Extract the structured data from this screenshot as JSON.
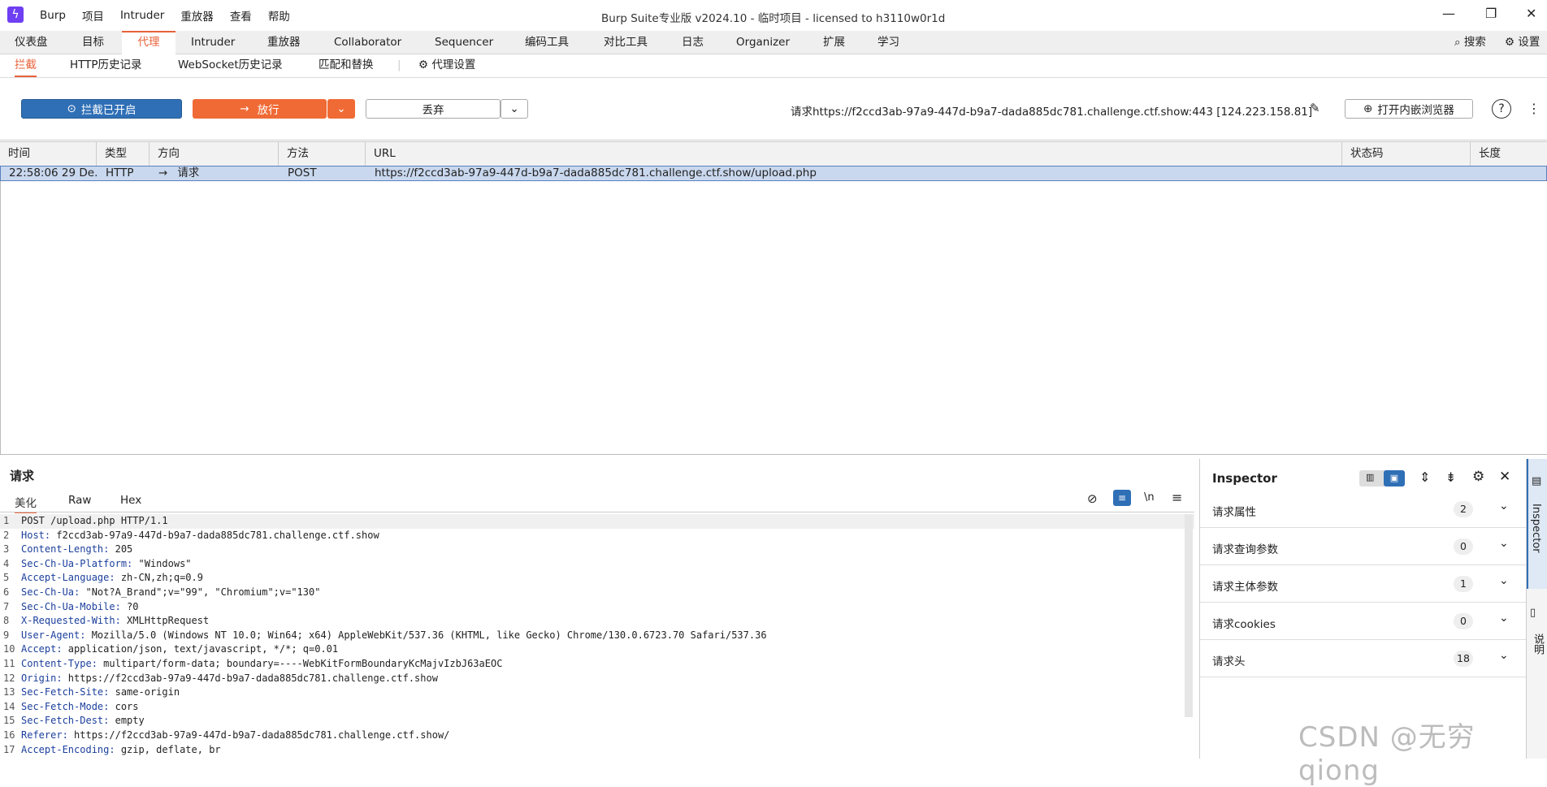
{
  "app": {
    "menu": [
      "Burp",
      "项目",
      "Intruder",
      "重放器",
      "查看",
      "帮助"
    ],
    "title": "Burp Suite专业版  v2024.10 - 临时项目 - licensed to h3110w0r1d"
  },
  "top_tabs": [
    "仪表盘",
    "目标",
    "代理",
    "Intruder",
    "重放器",
    "Collaborator",
    "Sequencer",
    "编码工具",
    "对比工具",
    "日志",
    "Organizer",
    "扩展",
    "学习"
  ],
  "top_right": {
    "search": "搜索",
    "settings": "设置"
  },
  "sub_tabs": [
    "拦截",
    "HTTP历史记录",
    "WebSocket历史记录",
    "匹配和替换",
    "代理设置"
  ],
  "toolbar": {
    "intercept": "拦截已开启",
    "forward": "放行",
    "drop": "丢弃",
    "request_info": "请求https://f2ccd3ab-97a9-447d-b9a7-dada885dc781.challenge.ctf.show:443  [124.223.158.81]",
    "open_browser": "打开内嵌浏览器",
    "help": "?"
  },
  "table": {
    "headers": [
      "时间",
      "类型",
      "方向",
      "方法",
      "URL",
      "状态码",
      "长度"
    ],
    "rows": [
      {
        "time": "22:58:06 29 De...",
        "type": "HTTP",
        "direction": "请求",
        "method": "POST",
        "url": "https://f2ccd3ab-97a9-447d-b9a7-dada885dc781.challenge.ctf.show/upload.php",
        "status": "",
        "length": ""
      }
    ]
  },
  "request_panel": {
    "title": "请求",
    "tabs": [
      "美化",
      "Raw",
      "Hex"
    ],
    "newline_toggle": "\\n",
    "lines": [
      {
        "n": "1",
        "key": "",
        "val": "POST /upload.php HTTP/1.1"
      },
      {
        "n": "2",
        "key": "Host:",
        "val": " f2ccd3ab-97a9-447d-b9a7-dada885dc781.challenge.ctf.show"
      },
      {
        "n": "3",
        "key": "Content-Length:",
        "val": " 205"
      },
      {
        "n": "4",
        "key": "Sec-Ch-Ua-Platform:",
        "val": " \"Windows\""
      },
      {
        "n": "5",
        "key": "Accept-Language:",
        "val": " zh-CN,zh;q=0.9"
      },
      {
        "n": "6",
        "key": "Sec-Ch-Ua:",
        "val": " \"Not?A_Brand\";v=\"99\", \"Chromium\";v=\"130\""
      },
      {
        "n": "7",
        "key": "Sec-Ch-Ua-Mobile:",
        "val": " ?0"
      },
      {
        "n": "8",
        "key": "X-Requested-With:",
        "val": " XMLHttpRequest"
      },
      {
        "n": "9",
        "key": "User-Agent:",
        "val": " Mozilla/5.0 (Windows NT 10.0; Win64; x64) AppleWebKit/537.36 (KHTML, like Gecko) Chrome/130.0.6723.70 Safari/537.36"
      },
      {
        "n": "10",
        "key": "Accept:",
        "val": " application/json, text/javascript, */*; q=0.01"
      },
      {
        "n": "11",
        "key": "Content-Type:",
        "val": " multipart/form-data; boundary=----WebKitFormBoundaryKcMajvIzbJ63aEOC"
      },
      {
        "n": "12",
        "key": "Origin:",
        "val": " https://f2ccd3ab-97a9-447d-b9a7-dada885dc781.challenge.ctf.show"
      },
      {
        "n": "13",
        "key": "Sec-Fetch-Site:",
        "val": " same-origin"
      },
      {
        "n": "14",
        "key": "Sec-Fetch-Mode:",
        "val": " cors"
      },
      {
        "n": "15",
        "key": "Sec-Fetch-Dest:",
        "val": " empty"
      },
      {
        "n": "16",
        "key": "Referer:",
        "val": " https://f2ccd3ab-97a9-447d-b9a7-dada885dc781.challenge.ctf.show/"
      },
      {
        "n": "17",
        "key": "Accept-Encoding:",
        "val": " gzip, deflate, br"
      }
    ]
  },
  "inspector": {
    "title": "Inspector",
    "sections": [
      {
        "label": "请求属性",
        "count": "2"
      },
      {
        "label": "请求查询参数",
        "count": "0"
      },
      {
        "label": "请求主体参数",
        "count": "1"
      },
      {
        "label": "请求cookies",
        "count": "0"
      },
      {
        "label": "请求头",
        "count": "18"
      }
    ]
  },
  "side_tabs": [
    "Inspector",
    "说明"
  ],
  "watermark": "CSDN @无穷qiong",
  "colors": {
    "accent": "#e8623a",
    "intercept_blue": "#2f6fb6",
    "forward_orange": "#f06a35"
  }
}
